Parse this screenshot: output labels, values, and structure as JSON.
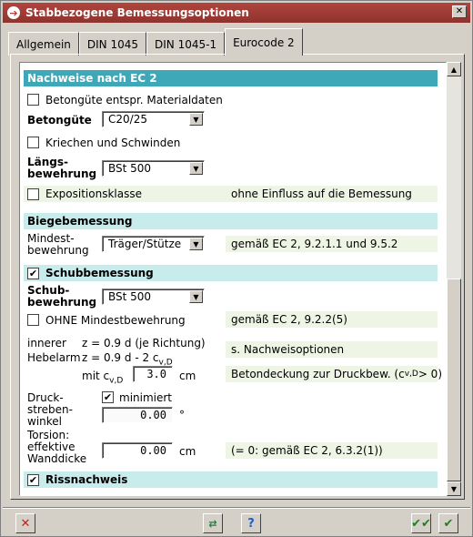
{
  "window": {
    "title": "Stabbezogene Bemessungsoptionen"
  },
  "tabs": [
    "Allgemein",
    "DIN 1045",
    "DIN 1045-1",
    "Eurocode 2"
  ],
  "content": {
    "section_title": "Nachweise nach EC 2",
    "betongute_checkbox": {
      "label": "Betongüte entspr. Materialdaten",
      "checked": false
    },
    "betongute": {
      "label": "Betongüte",
      "value": "C20/25"
    },
    "kriechen": {
      "label": "Kriechen und Schwinden",
      "checked": false
    },
    "laengs": {
      "label1": "Längs-",
      "label2": "bewehrung",
      "value": "BSt 500"
    },
    "exposition": {
      "label": "Expositionsklasse",
      "note": "ohne Einfluss auf die Bemessung",
      "checked": false
    },
    "biege": {
      "title": "Biegebemessung",
      "label1": "Mindest-",
      "label2": "bewehrung",
      "value": "Träger/Stütze",
      "note": "gemäß EC 2, 9.2.1.1 und 9.5.2"
    },
    "schub": {
      "title": "Schubbemessung",
      "checked": true,
      "bew_label1": "Schub-",
      "bew_label2": "bewehrung",
      "bew_value": "BSt 500",
      "ohne_label": "OHNE Mindestbewehrung",
      "ohne_checked": false,
      "ohne_note": "gemäß EC 2, 9.2.2(5)",
      "hebel_label1": "innerer",
      "hebel_label2": "Hebelarm",
      "z_line1": "z = 0.9 d (je Richtung)",
      "z_line2_pre": "z = 0.9 d - 2 c",
      "z_sub": "v,D",
      "hebel_note": "s. Nachweisoptionen",
      "mit_label": "mit c",
      "mit_sub": "v,D",
      "mit_value": "3.0",
      "mit_unit": "cm",
      "mit_note_pre": "Betondeckung zur Druckbew. (c",
      "mit_note_sub": "v,D",
      "mit_note_post": " > 0)",
      "druck_label1": "Druck-",
      "druck_label2": "streben-",
      "druck_label3": "winkel",
      "minimiert_label": "minimiert",
      "minimiert_checked": true,
      "winkel_value": "0.00",
      "winkel_unit": "°",
      "tors_label1": "Torsion:",
      "tors_label2": "effektive",
      "tors_label3": "Wanddicke",
      "tors_value": "0.00",
      "tors_unit": "cm",
      "tors_note": "(= 0: gemäß EC 2, 6.3.2(1))"
    },
    "riss": {
      "title": "Rissnachweis",
      "checked": true
    }
  },
  "footer": {
    "cancel_icon": "cancel-x-icon",
    "transfer_icon": "transfer-icon",
    "help_icon": "help-icon",
    "apply_all_icon": "apply-all-icon",
    "ok_icon": "ok-check-icon"
  }
}
